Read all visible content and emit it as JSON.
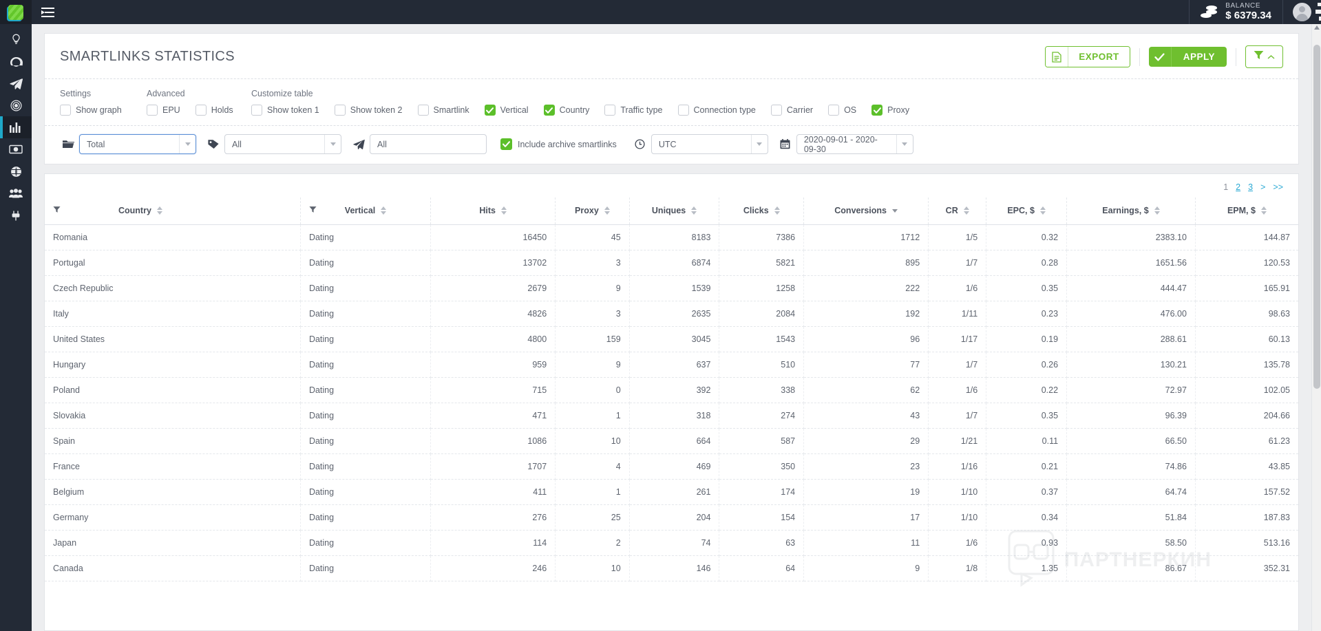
{
  "topbar": {
    "logo_icon": "logo-mark-icon",
    "menu_icon": "hamburger-menu-icon",
    "balance_label": "BALANCE",
    "balance_amount": "$ 6379.34",
    "coins_icon": "coins-icon",
    "avatar_icon": "user-avatar-icon"
  },
  "sidebar": {
    "items": [
      {
        "name": "sidebar-item-offers",
        "icon": "lightbulb-icon",
        "active": false
      },
      {
        "name": "sidebar-item-dashboard",
        "icon": "speedometer-icon",
        "active": false
      },
      {
        "name": "sidebar-item-smartlinks",
        "icon": "paper-plane-icon",
        "active": false
      },
      {
        "name": "sidebar-item-targets",
        "icon": "target-icon",
        "active": false
      },
      {
        "name": "sidebar-item-statistics",
        "icon": "bar-chart-icon",
        "active": true
      },
      {
        "name": "sidebar-item-finances",
        "icon": "banknote-icon",
        "active": false
      },
      {
        "name": "sidebar-item-globe",
        "icon": "globe-icon",
        "active": false
      },
      {
        "name": "sidebar-item-referrals",
        "icon": "users-icon",
        "active": false
      },
      {
        "name": "sidebar-item-tools",
        "icon": "plug-icon",
        "active": false
      }
    ]
  },
  "header": {
    "title": "SMARTLINKS STATISTICS",
    "export_label": "EXPORT",
    "export_icon": "document-icon",
    "apply_label": "APPLY",
    "apply_icon": "check-icon",
    "filter_icon": "funnel-icon",
    "filter_caret_icon": "chevron-up-icon",
    "accent_green": "#6fbf2f"
  },
  "settings": {
    "groups": [
      {
        "title": "Settings",
        "name": "group-settings"
      },
      {
        "title": "Advanced",
        "name": "group-advanced"
      },
      {
        "title": "Customize table",
        "name": "group-customize-table"
      }
    ],
    "settings_checkboxes": [
      {
        "label": "Show graph",
        "checked": false,
        "name": "checkbox-show-graph"
      }
    ],
    "advanced_checkboxes": [
      {
        "label": "EPU",
        "checked": false,
        "name": "checkbox-epu"
      },
      {
        "label": "Holds",
        "checked": false,
        "name": "checkbox-holds"
      }
    ],
    "customize_checkboxes": [
      {
        "label": "Show token 1",
        "checked": false,
        "name": "checkbox-show-token-1"
      },
      {
        "label": "Show token 2",
        "checked": false,
        "name": "checkbox-show-token-2"
      },
      {
        "label": "Smartlink",
        "checked": false,
        "name": "checkbox-smartlink"
      },
      {
        "label": "Vertical",
        "checked": true,
        "name": "checkbox-vertical"
      },
      {
        "label": "Country",
        "checked": true,
        "name": "checkbox-country"
      },
      {
        "label": "Traffic type",
        "checked": false,
        "name": "checkbox-traffic-type"
      },
      {
        "label": "Connection type",
        "checked": false,
        "name": "checkbox-connection-type"
      },
      {
        "label": "Carrier",
        "checked": false,
        "name": "checkbox-carrier"
      },
      {
        "label": "OS",
        "checked": false,
        "name": "checkbox-os"
      },
      {
        "label": "Proxy",
        "checked": true,
        "name": "checkbox-proxy"
      }
    ]
  },
  "filters": {
    "smartlink_select": {
      "value": "Total",
      "icon": "folder-icon",
      "focused": true
    },
    "tag_select": {
      "value": "All",
      "icon": "tag-icon",
      "focused": false
    },
    "plane_select": {
      "value": "All",
      "icon": "paper-plane-icon",
      "focused": false
    },
    "include_archive": {
      "label": "Include archive smartlinks",
      "checked": true
    },
    "timezone_select": {
      "value": "UTC",
      "icon": "clock-icon"
    },
    "date_range_select": {
      "value": "2020-09-01 - 2020-09-30",
      "icon": "calendar-icon"
    }
  },
  "pagination": {
    "current": "1",
    "pages": [
      "2",
      "3"
    ],
    "next": ">",
    "last": ">>"
  },
  "table": {
    "columns": [
      {
        "label": "Country",
        "align": "left",
        "sort": "both",
        "filter": true,
        "cls": "col-country"
      },
      {
        "label": "Vertical",
        "align": "center",
        "sort": "both",
        "filter": true,
        "cls": "col-vertical"
      },
      {
        "label": "Hits",
        "align": "center",
        "sort": "both",
        "filter": false,
        "cls": "col-hits"
      },
      {
        "label": "Proxy",
        "align": "center",
        "sort": "both",
        "filter": false,
        "cls": "col-proxy"
      },
      {
        "label": "Uniques",
        "align": "center",
        "sort": "both",
        "filter": false,
        "cls": "col-uniq"
      },
      {
        "label": "Clicks",
        "align": "center",
        "sort": "both",
        "filter": false,
        "cls": "col-clicks"
      },
      {
        "label": "Conversions",
        "align": "center",
        "sort": "desc",
        "filter": false,
        "cls": "col-conv"
      },
      {
        "label": "CR",
        "align": "center",
        "sort": "both",
        "filter": false,
        "cls": "col-cr"
      },
      {
        "label": "EPC, $",
        "align": "center",
        "sort": "both",
        "filter": false,
        "cls": "col-epc"
      },
      {
        "label": "Earnings, $",
        "align": "center",
        "sort": "both",
        "filter": false,
        "cls": "col-earn"
      },
      {
        "label": "EPM, $",
        "align": "center",
        "sort": "both",
        "filter": false,
        "cls": "col-epm"
      }
    ],
    "rows": [
      [
        "Romania",
        "Dating",
        "16450",
        "45",
        "8183",
        "7386",
        "1712",
        "1/5",
        "0.32",
        "2383.10",
        "144.87"
      ],
      [
        "Portugal",
        "Dating",
        "13702",
        "3",
        "6874",
        "5821",
        "895",
        "1/7",
        "0.28",
        "1651.56",
        "120.53"
      ],
      [
        "Czech Republic",
        "Dating",
        "2679",
        "9",
        "1539",
        "1258",
        "222",
        "1/6",
        "0.35",
        "444.47",
        "165.91"
      ],
      [
        "Italy",
        "Dating",
        "4826",
        "3",
        "2635",
        "2084",
        "192",
        "1/11",
        "0.23",
        "476.00",
        "98.63"
      ],
      [
        "United States",
        "Dating",
        "4800",
        "159",
        "3045",
        "1543",
        "96",
        "1/17",
        "0.19",
        "288.61",
        "60.13"
      ],
      [
        "Hungary",
        "Dating",
        "959",
        "9",
        "637",
        "510",
        "77",
        "1/7",
        "0.26",
        "130.21",
        "135.78"
      ],
      [
        "Poland",
        "Dating",
        "715",
        "0",
        "392",
        "338",
        "62",
        "1/6",
        "0.22",
        "72.97",
        "102.05"
      ],
      [
        "Slovakia",
        "Dating",
        "471",
        "1",
        "318",
        "274",
        "43",
        "1/7",
        "0.35",
        "96.39",
        "204.66"
      ],
      [
        "Spain",
        "Dating",
        "1086",
        "10",
        "664",
        "587",
        "29",
        "1/21",
        "0.11",
        "66.50",
        "61.23"
      ],
      [
        "France",
        "Dating",
        "1707",
        "4",
        "469",
        "350",
        "23",
        "1/16",
        "0.21",
        "74.86",
        "43.85"
      ],
      [
        "Belgium",
        "Dating",
        "411",
        "1",
        "261",
        "174",
        "19",
        "1/10",
        "0.37",
        "64.74",
        "157.52"
      ],
      [
        "Germany",
        "Dating",
        "276",
        "25",
        "204",
        "154",
        "17",
        "1/10",
        "0.34",
        "51.84",
        "187.83"
      ],
      [
        "Japan",
        "Dating",
        "114",
        "2",
        "74",
        "63",
        "11",
        "1/6",
        "0.93",
        "58.50",
        "513.16"
      ],
      [
        "Canada",
        "Dating",
        "246",
        "10",
        "146",
        "64",
        "9",
        "1/8",
        "1.35",
        "86.67",
        "352.31"
      ]
    ]
  },
  "watermark": {
    "text": "ПАРТНЕРКИН",
    "icon": "mascot-icon"
  }
}
